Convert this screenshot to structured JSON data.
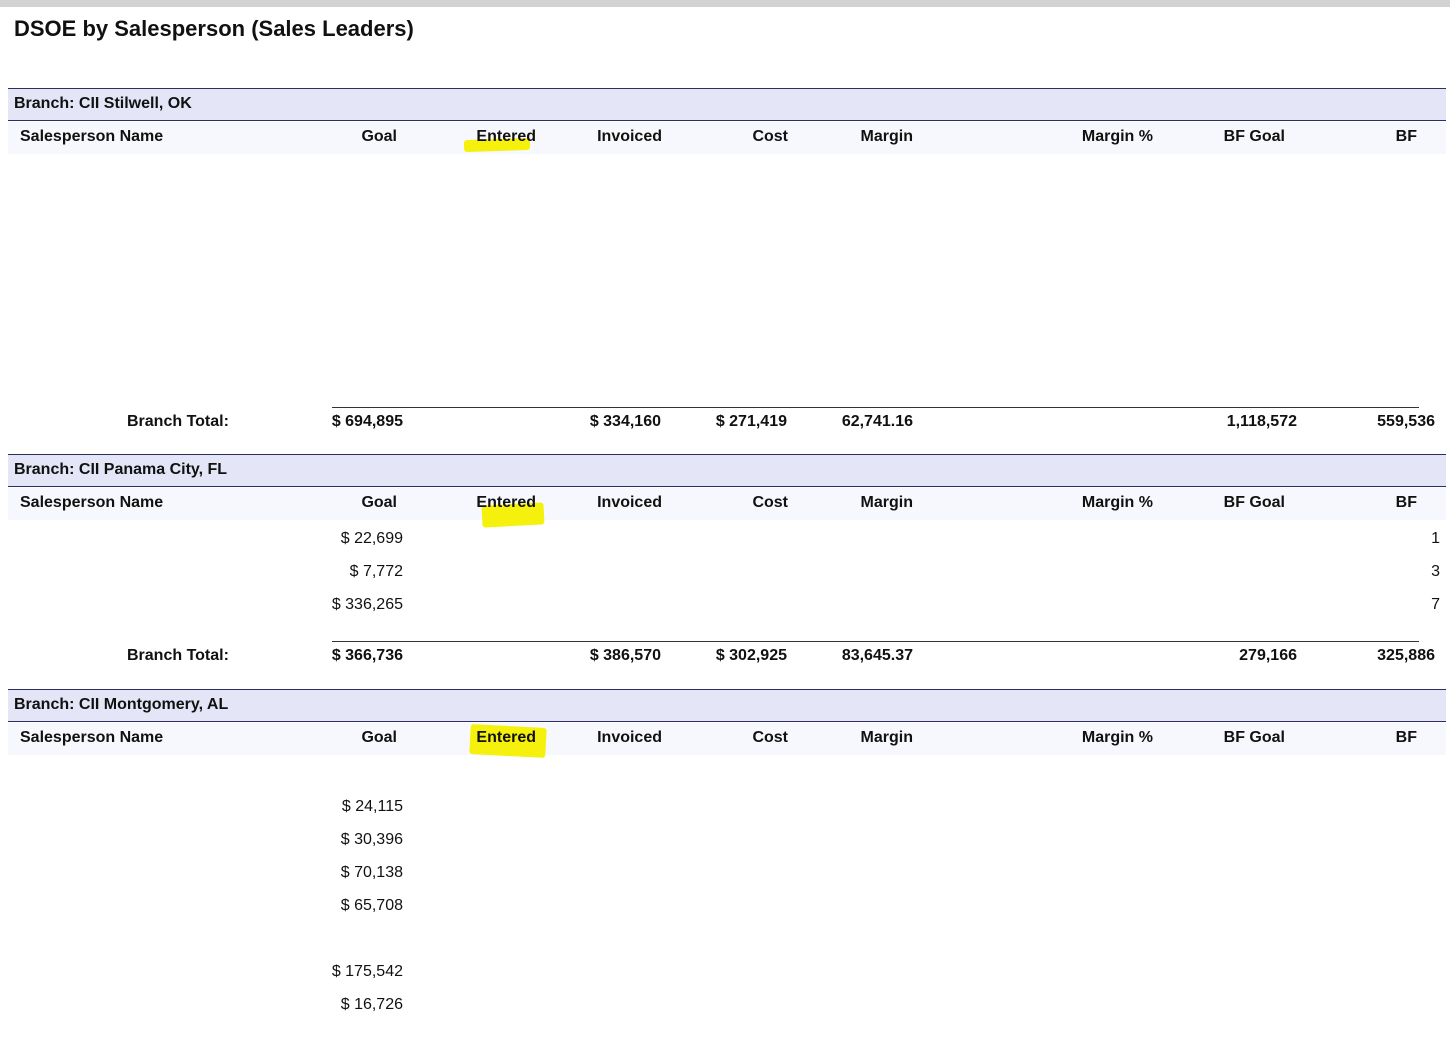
{
  "report": {
    "title": "DSOE by Salesperson (Sales Leaders)"
  },
  "columns": {
    "name": "Salesperson Name",
    "goal": "Goal",
    "entered": "Entered",
    "invoiced": "Invoiced",
    "cost": "Cost",
    "margin": "Margin",
    "margin_pct": "Margin %",
    "bf_goal": "BF Goal",
    "bf": "BF"
  },
  "branches": [
    {
      "label": "Branch: CII Stilwell, OK",
      "rows": [],
      "total": {
        "label": "Branch Total:",
        "goal": "$ 694,895",
        "invoiced": "$ 334,160",
        "cost": "$ 271,419",
        "margin": "62,741.16",
        "bf_goal": "1,118,572",
        "bf": "559,536"
      }
    },
    {
      "label": "Branch: CII Panama City, FL",
      "rows": [
        {
          "goal": "$ 22,699",
          "bf": "1"
        },
        {
          "goal": "$ 7,772",
          "bf": "3"
        },
        {
          "goal": "$ 336,265",
          "bf": "7"
        }
      ],
      "total": {
        "label": "Branch Total:",
        "goal": "$ 366,736",
        "invoiced": "$ 386,570",
        "cost": "$ 302,925",
        "margin": "83,645.37",
        "bf_goal": "279,166",
        "bf": "325,886"
      }
    },
    {
      "label": "Branch: CII Montgomery, AL",
      "rows": [
        {
          "goal": "$ 24,115"
        },
        {
          "goal": "$ 30,396"
        },
        {
          "goal": "$ 70,138"
        },
        {
          "goal": "$ 65,708"
        },
        {
          "goal": "$ 175,542"
        },
        {
          "goal": "$ 16,726"
        }
      ]
    }
  ],
  "colors": {
    "branch_bar": "#e4e6f8",
    "header_row": "#f7f8fd",
    "highlight": "#f4f000"
  }
}
